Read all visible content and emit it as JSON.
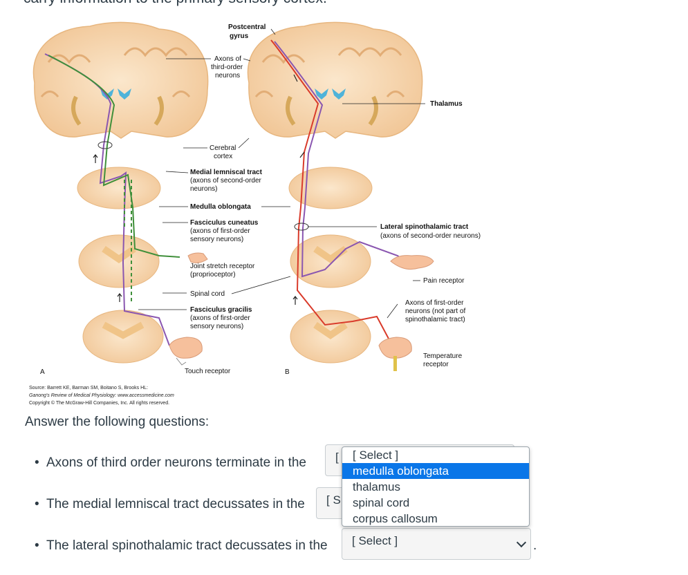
{
  "top_text": "carry information to the primary sensory cortex.",
  "figure": {
    "labels": {
      "postcentral_gyrus_1": "Postcentral",
      "postcentral_gyrus_2": "gyrus",
      "axons_third_1": "Axons of",
      "axons_third_2": "third-order",
      "axons_third_3": "neurons",
      "thalamus": "Thalamus",
      "cerebral_cortex_1": "Cerebral",
      "cerebral_cortex_2": "cortex",
      "medial_lemniscal_1": "Medial lemniscal tract",
      "medial_lemniscal_2": "(axons of second-order",
      "medial_lemniscal_3": "neurons)",
      "medulla_oblongata": "Medulla oblongata",
      "fasciculus_cuneatus_1": "Fasciculus cuneatus",
      "fasciculus_cuneatus_2": "(axons of first-order",
      "fasciculus_cuneatus_3": "sensory neurons)",
      "lateral_spino_1": "Lateral spinothalamic tract",
      "lateral_spino_2": "(axons of second-order neurons)",
      "joint_stretch_1": "Joint stretch receptor",
      "joint_stretch_2": "(proprioceptor)",
      "pain_receptor": "Pain receptor",
      "spinal_cord": "Spinal cord",
      "axons_first_1": "Axons of first-order",
      "axons_first_2": "neurons (not part of",
      "axons_first_3": "spinothalamic tract)",
      "fasciculus_gracilis_1": "Fasciculus gracilis",
      "fasciculus_gracilis_2": "(axons of first-order",
      "fasciculus_gracilis_3": "sensory neurons)",
      "temperature_1": "Temperature",
      "temperature_2": "receptor",
      "touch_receptor": "Touch receptor",
      "panel_a": "A",
      "panel_b": "B"
    },
    "source_line1": "Source: Barrett KE, Barman SM, Boitano S, Brooks HL:",
    "source_line2": "Ganong's Review of Medical Physiology: www.accessmedicine.com",
    "source_line3": "Copyright © The McGraw-Hill Companies, Inc. All rights reserved."
  },
  "heading": "Answer the following questions:",
  "questions": [
    {
      "text": "Axons of third order neurons terminate in the",
      "select_value": "[ Select ]",
      "select_partial": "["
    },
    {
      "text": "The medial lemniscal tract decussates in the",
      "select_value": "[ Select ]",
      "select_partial": "[ S"
    },
    {
      "text": "The lateral spinothalamic tract decussates in the",
      "select_value": "[ Select ]"
    }
  ],
  "dropdown_options": [
    "[ Select ]",
    "medulla oblongata",
    "thalamus",
    "spinal cord",
    "corpus callosum"
  ],
  "dropdown_highlighted_index": 1,
  "end_punctuation": ".",
  "colors": {
    "text": "#2d3b45",
    "highlight": "#0a76e8",
    "tissue": "#f5d2a6",
    "ventricle": "#4fb3d9",
    "tract_red": "#d93a2a",
    "tract_purple": "#8a56b0",
    "tract_green": "#3f8f3a"
  }
}
